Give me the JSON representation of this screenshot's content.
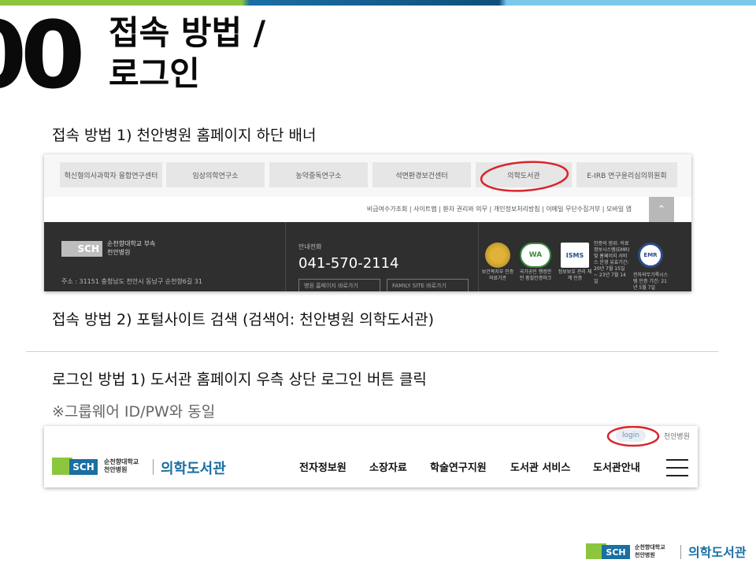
{
  "slide": {
    "number": "00",
    "title_line1": "접속 방법 /",
    "title_line2": "로그인",
    "step1": "접속 방법 1) 천안병원 홈페이지 하단 배너",
    "step2": "접속 방법 2) 포털사이트 검색 (검색어: 천안병원 의학도서관)",
    "step3": "로그인 방법 1)  도서관 홈페이지 우측 상단 로그인 버튼 클릭",
    "note": "※그룹웨어 ID/PW와 동일"
  },
  "colors": {
    "green": "#8cc63f",
    "blue": "#1a6fa3",
    "highlight_red": "#d9242b"
  },
  "screenshot1": {
    "tabs": [
      "혁신형의사과학자 융합연구센터",
      "임상의학연구소",
      "농약중독연구소",
      "석면환경보건센터",
      "의학도서관",
      "E-IRB 연구윤리심의위원회"
    ],
    "links": "비급여수가조회  |  사이트맵  |  환자 권리와 의무  |  개인정보처리방침  |  이메일 무단수집거부  |  모바일 앱",
    "up_icon": "chevron-up-icon",
    "logo": "SCH",
    "logo_text1": "순천향대학교 부속",
    "logo_text2": "천안병원",
    "address": "주소 : 31151 충청남도 천안시 동남구 순천향6길 31",
    "phone_label": "안내전화",
    "phone": "041-570-2114",
    "button1": "병원 홈페이지 바로가기",
    "button2": "FAMILY SITE 바로가기",
    "cert1_caption": "보건복지부 인증 의료기관",
    "cert2_caption": "국가공인 행정안전 품질인증마크",
    "cert3_caption": "정보보호 관리 체계 인증",
    "cert_text": "인증의 범위: 의료정보시스템(EMR) 및 홈페이지 서비스 운영 유효기간: 20년 7월 15일 ~ 23년 7월 14일",
    "cert_text2": "전자의무기록시스템 인증 기간: 21년 5월 7일",
    "cert_isms": "ISMS",
    "cert_emr": "EMR"
  },
  "screenshot2": {
    "login": "login",
    "hospital_link": "천안병원",
    "logo": "SCH",
    "org_line1": "순천향대학교",
    "org_line2": "천안병원",
    "library_name": "의학도서관",
    "menu": [
      "전자정보원",
      "소장자료",
      "학술연구지원",
      "도서관 서비스",
      "도서관안내"
    ],
    "menu_icon": "hamburger-icon"
  },
  "footer_logo": {
    "logo": "SCH",
    "org_line1": "순천향대학교",
    "org_line2": "천안병원",
    "library_name": "의학도서관"
  }
}
